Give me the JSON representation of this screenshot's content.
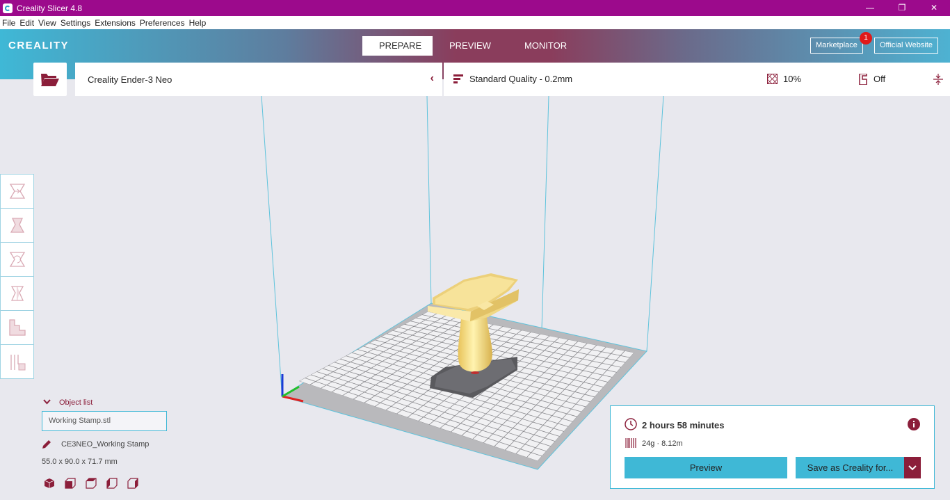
{
  "window": {
    "title": "Creality Slicer 4.8",
    "controls": [
      "—",
      "❐",
      "✕"
    ]
  },
  "menu": [
    "File",
    "Edit",
    "View",
    "Settings",
    "Extensions",
    "Preferences",
    "Help"
  ],
  "header": {
    "logo": "CREALITY",
    "tabs": [
      {
        "label": "PREPARE",
        "active": true
      },
      {
        "label": "PREVIEW",
        "active": false
      },
      {
        "label": "MONITOR",
        "active": false
      }
    ],
    "marketplace_label": "Marketplace",
    "marketplace_badge": "1",
    "website_label": "Official Website"
  },
  "printer": {
    "name": "Creality Ender-3 Neo"
  },
  "print_settings": {
    "quality": "Standard Quality - 0.2mm",
    "infill": "10%",
    "support": "Off"
  },
  "tools": [
    "move-tool",
    "scale-tool",
    "rotate-tool",
    "mirror-tool",
    "per-model-settings-tool",
    "support-blocker-tool"
  ],
  "object_list": {
    "header": "Object list",
    "items": [
      "Working Stamp.stl"
    ],
    "job_name": "CE3NEO_Working Stamp",
    "dimensions": "55.0 x 90.0 x 71.7 mm"
  },
  "print_info": {
    "time": "2 hours 58 minutes",
    "material": "24g · 8.12m",
    "preview_label": "Preview",
    "save_label": "Save as Creality for..."
  },
  "colors": {
    "titlebar": "#9c0a8c",
    "accent": "#3fb8d6",
    "brand_red": "#8b1e3a",
    "model": "#f2d77e"
  }
}
